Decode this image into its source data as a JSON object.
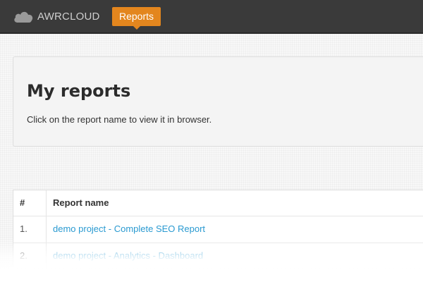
{
  "header": {
    "brand": "AWRCLOUD",
    "nav": {
      "reports_label": "Reports"
    },
    "accent_color": "#e3861e",
    "brand_icon": "cloud-icon"
  },
  "hero": {
    "title": "My reports",
    "subtitle": "Click on the report name to view it in browser."
  },
  "reports_table": {
    "columns": [
      "#",
      "Report name"
    ],
    "rows": [
      {
        "num": "1.",
        "name": "demo project - Complete SEO Report"
      },
      {
        "num": "2.",
        "name": "demo project - Analytics - Dashboard"
      }
    ],
    "link_color": "#2a9ad1"
  }
}
